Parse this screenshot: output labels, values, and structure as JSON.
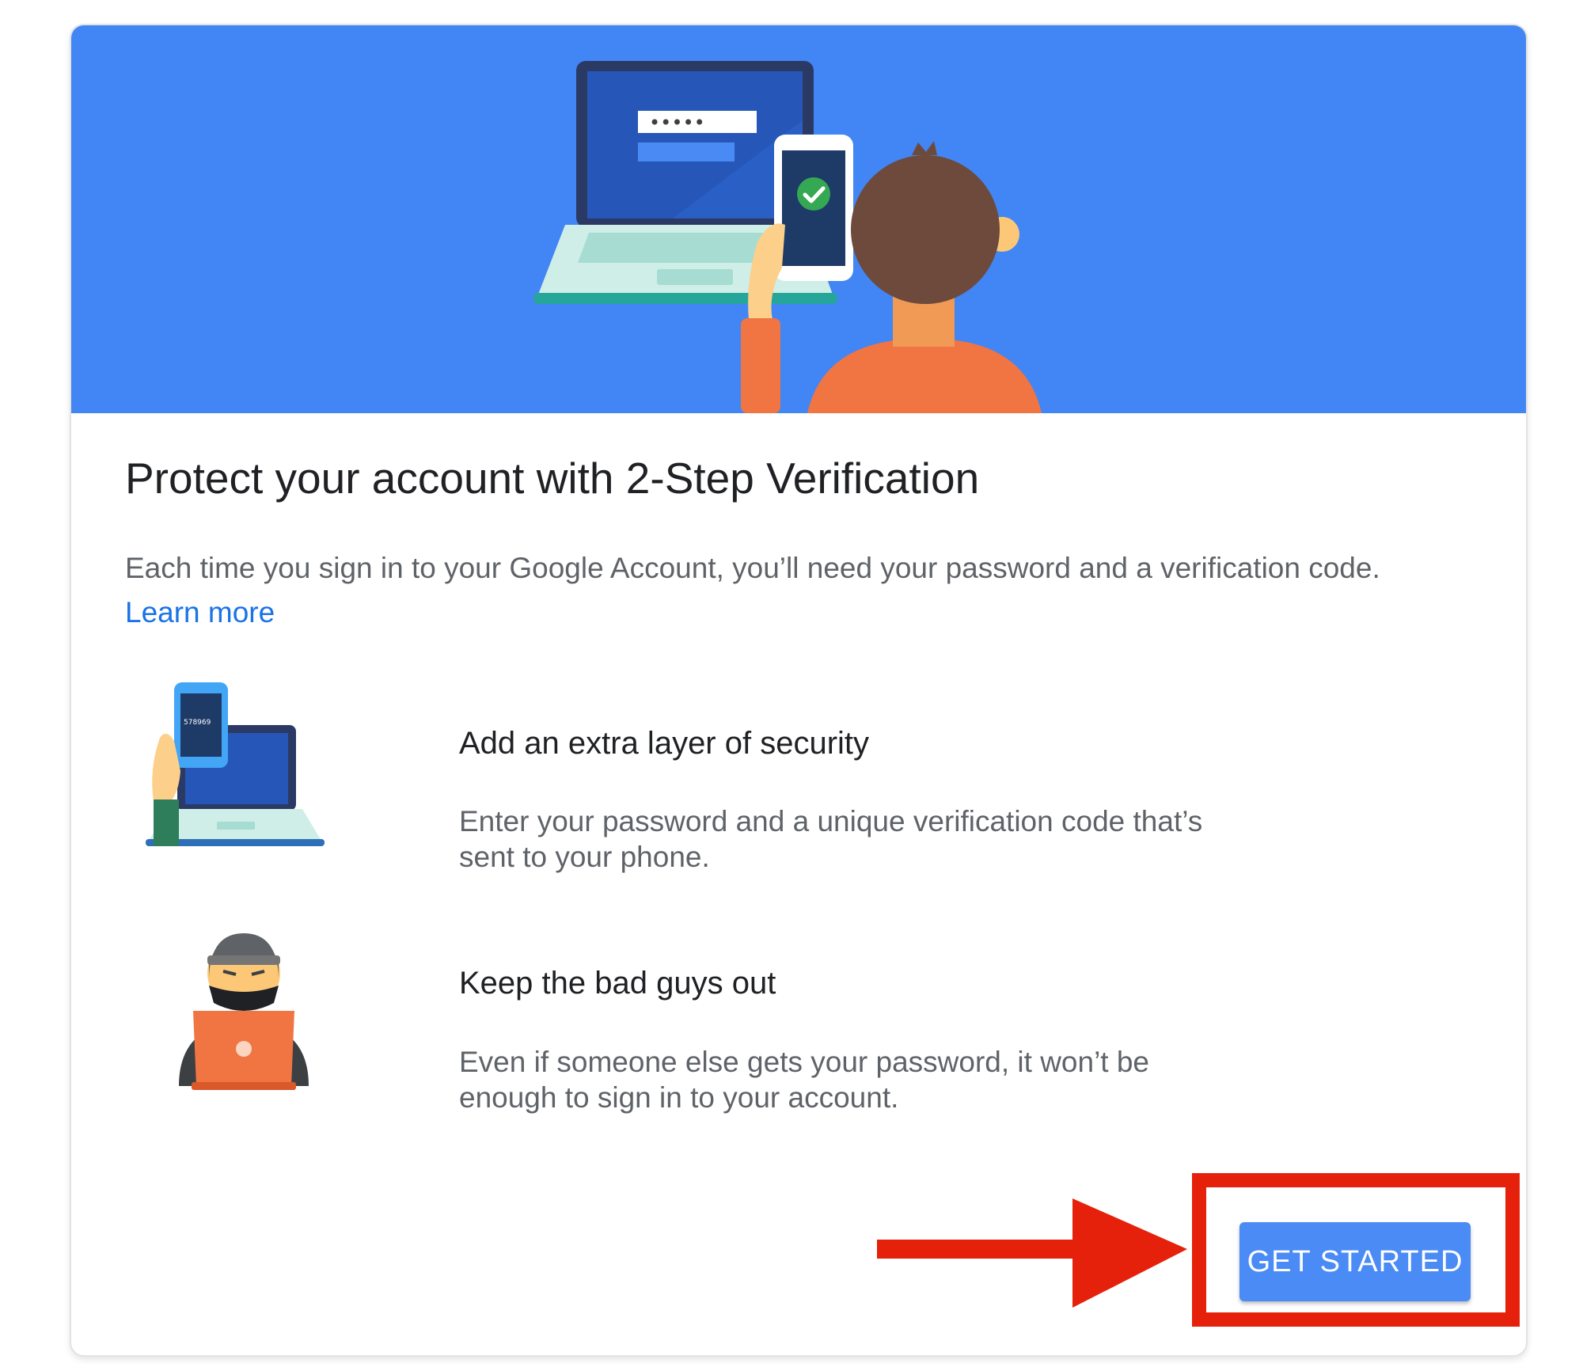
{
  "card": {
    "title": "Protect your account with 2-Step Verification",
    "description": "Each time you sign in to your Google Account, you’ll need your password and a verification code.",
    "learn_more": "Learn more",
    "features": [
      {
        "icon": "phone-laptop-icon",
        "title": "Add an extra layer of security",
        "description": "Enter your password and a unique verification code that’s sent to your phone.",
        "phone_code": "578969"
      },
      {
        "icon": "hacker-icon",
        "title": "Keep the bad guys out",
        "description": "Even if someone else gets your password, it won’t be enough to sign in to your account."
      }
    ],
    "get_started": "GET STARTED"
  },
  "hero": {
    "password_mask": "•••••"
  },
  "annotation": {
    "highlight_color": "#e5210b",
    "target": "get-started-button"
  },
  "colors": {
    "header_bg": "#4285f4",
    "link": "#1a73e8",
    "button_bg": "#4a8bf5",
    "title_text": "#202124",
    "body_text": "#5f6368"
  }
}
